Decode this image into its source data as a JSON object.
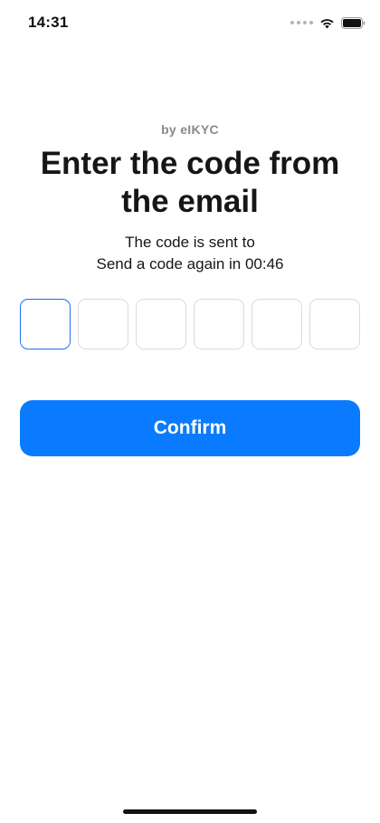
{
  "status_bar": {
    "time": "14:31",
    "icons": [
      "signal-dots-icon",
      "wifi-icon",
      "battery-icon"
    ]
  },
  "header": {
    "brand": "by eIKYC",
    "title": "Enter the code from the email",
    "subtitle_line1": "The code is sent to",
    "subtitle_line2": "Send a code again in 00:46"
  },
  "code_input": {
    "length": 6,
    "values": [
      "",
      "",
      "",
      "",
      "",
      ""
    ],
    "active_index": 0
  },
  "actions": {
    "confirm_label": "Confirm"
  },
  "colors": {
    "accent": "#0a7bff",
    "active_border": "#1e6ff0",
    "box_border": "#dcdcdc",
    "muted_text": "#8a8a8e"
  }
}
